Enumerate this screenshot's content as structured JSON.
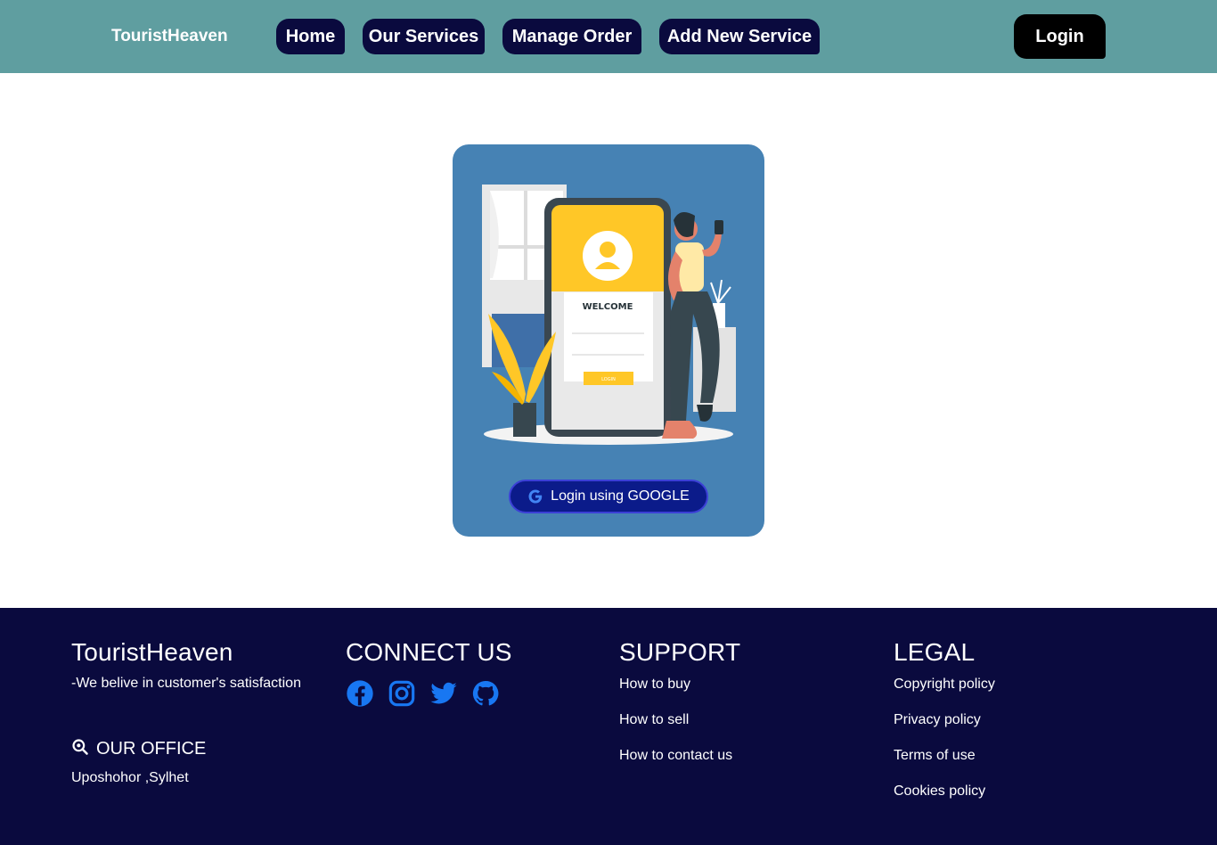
{
  "nav": {
    "brand": "TouristHeaven",
    "items": [
      {
        "label": "Home"
      },
      {
        "label": "Our Services"
      },
      {
        "label": "Manage Order"
      },
      {
        "label": "Add New Service"
      }
    ],
    "login_label": "Login"
  },
  "card": {
    "illustration": {
      "welcome_text": "WELCOME",
      "login_text": "LOGIN"
    },
    "google_button_label": "Login using GOOGLE"
  },
  "footer": {
    "brand": "TouristHeaven",
    "tagline": "-We belive in customer's satisfaction",
    "office_title": "OUR OFFICE",
    "office_address": "Uposhohor ,Sylhet",
    "connect_title": "CONNECT US",
    "social_icons": [
      "facebook-icon",
      "instagram-icon",
      "twitter-icon",
      "github-icon"
    ],
    "support_title": "SUPPORT",
    "support_links": [
      "How to buy",
      "How to sell",
      "How to contact us"
    ],
    "legal_title": "LEGAL",
    "legal_links": [
      "Copyright policy",
      "Privacy policy",
      "Terms of use",
      "Cookies policy"
    ]
  },
  "colors": {
    "navbar": "#5f9ea0",
    "nav_button": "#0a0a3e",
    "card": "#4682b4",
    "footer": "#0a0a3e",
    "social": "#1877f2",
    "illustration_yellow": "#ffc727"
  }
}
